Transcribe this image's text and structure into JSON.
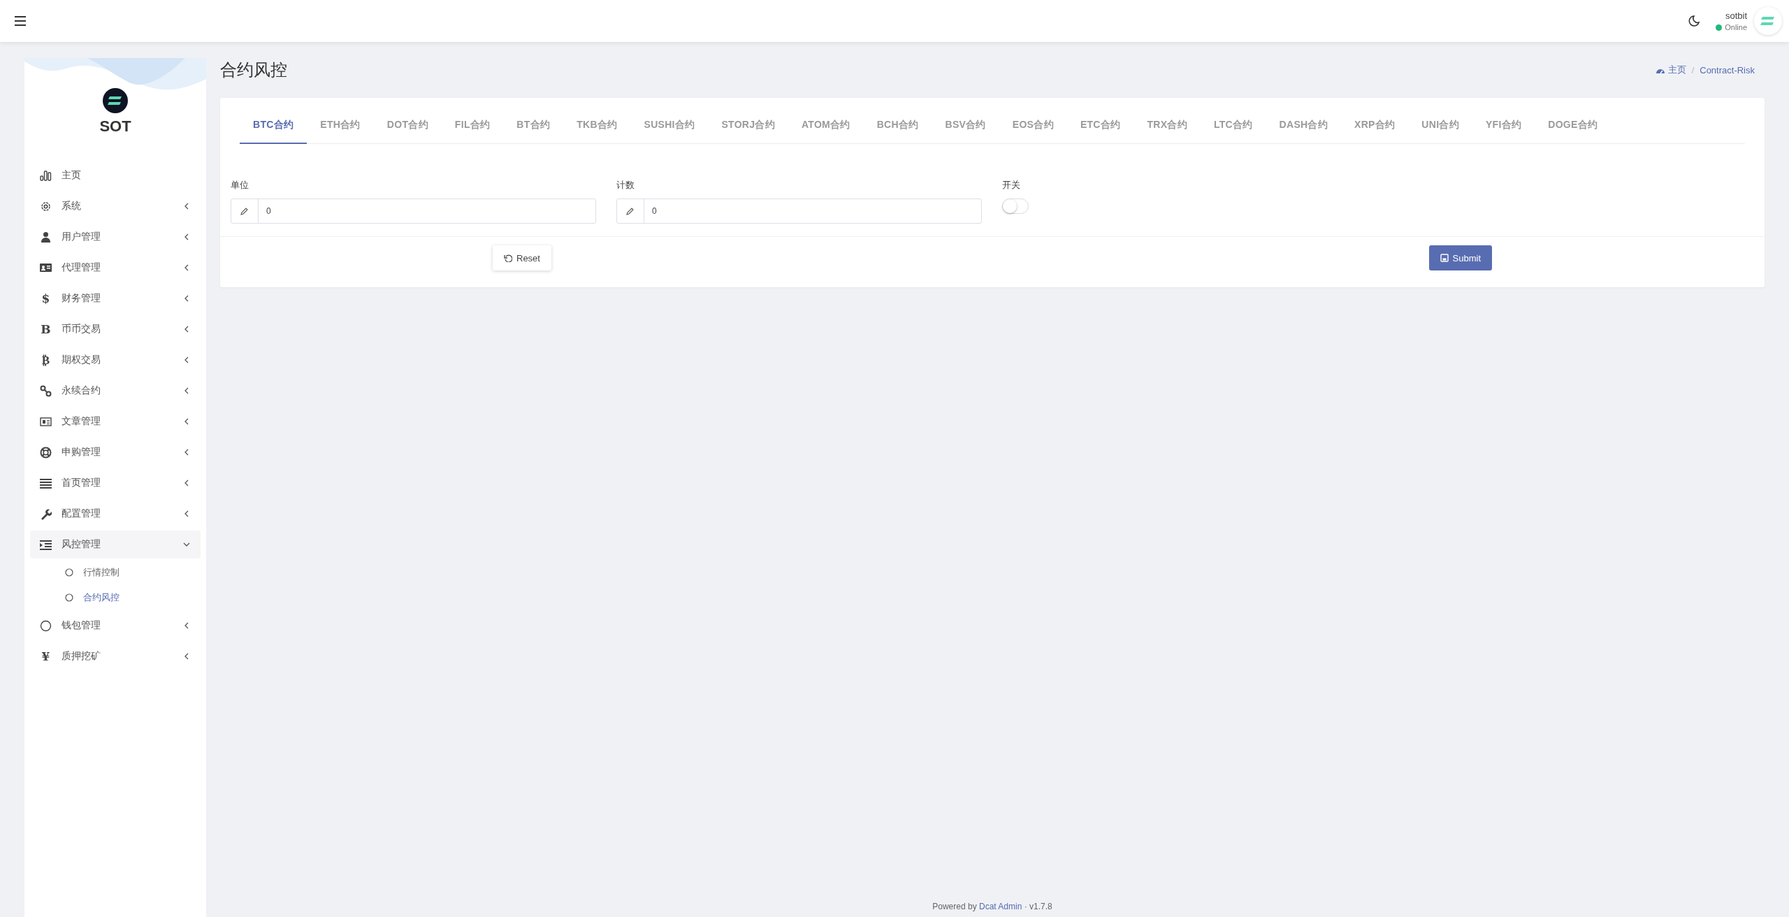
{
  "topbar": {
    "user": {
      "name": "sotbit",
      "status": "Online",
      "online": true
    }
  },
  "sidebar": {
    "brand": "SOT",
    "items": [
      {
        "label": "主页",
        "kind": "link"
      },
      {
        "label": "系统",
        "kind": "group",
        "expanded": false
      },
      {
        "label": "用户管理",
        "kind": "group",
        "expanded": false
      },
      {
        "label": "代理管理",
        "kind": "group",
        "expanded": false
      },
      {
        "label": "财务管理",
        "glyph": "$",
        "kind": "group",
        "expanded": false
      },
      {
        "label": "币币交易",
        "glyph": "B",
        "kind": "group",
        "expanded": false
      },
      {
        "label": "期权交易",
        "glyph": "₿",
        "kind": "group",
        "expanded": false
      },
      {
        "label": "永续合约",
        "kind": "group",
        "expanded": false
      },
      {
        "label": "文章管理",
        "kind": "group",
        "expanded": false
      },
      {
        "label": "申购管理",
        "kind": "group",
        "expanded": false
      },
      {
        "label": "首页管理",
        "kind": "group",
        "expanded": false
      },
      {
        "label": "配置管理",
        "kind": "group",
        "expanded": false
      },
      {
        "label": "风控管理",
        "kind": "group",
        "expanded": true,
        "children": [
          {
            "label": "行情控制",
            "selected": false
          },
          {
            "label": "合约风控",
            "selected": true
          }
        ]
      },
      {
        "label": "钱包管理",
        "kind": "group",
        "expanded": false
      },
      {
        "label": "质押挖矿",
        "glyph": "¥",
        "kind": "group",
        "expanded": false
      }
    ]
  },
  "header": {
    "title": "合约风控",
    "separator": "/",
    "breadcrumb": [
      {
        "label": "主页"
      },
      {
        "label": "Contract-Risk"
      }
    ]
  },
  "tabs": [
    {
      "label": "BTC合约",
      "selected": true
    },
    {
      "label": "ETH合约",
      "selected": false
    },
    {
      "label": "DOT合约",
      "selected": false
    },
    {
      "label": "FIL合约",
      "selected": false
    },
    {
      "label": "BT合约",
      "selected": false
    },
    {
      "label": "TKB合约",
      "selected": false
    },
    {
      "label": "SUSHI合约",
      "selected": false
    },
    {
      "label": "STORJ合约",
      "selected": false
    },
    {
      "label": "ATOM合约",
      "selected": false
    },
    {
      "label": "BCH合约",
      "selected": false
    },
    {
      "label": "BSV合约",
      "selected": false
    },
    {
      "label": "EOS合约",
      "selected": false
    },
    {
      "label": "ETC合约",
      "selected": false
    },
    {
      "label": "TRX合约",
      "selected": false
    },
    {
      "label": "LTC合约",
      "selected": false
    },
    {
      "label": "DASH合约",
      "selected": false
    },
    {
      "label": "XRP合约",
      "selected": false
    },
    {
      "label": "UNI合约",
      "selected": false
    },
    {
      "label": "YFI合约",
      "selected": false
    },
    {
      "label": "DOGE合约",
      "selected": false
    }
  ],
  "form": {
    "fields": [
      {
        "label": "单位",
        "kind": "text",
        "value": "0"
      },
      {
        "label": "计数",
        "kind": "text",
        "value": "0"
      },
      {
        "label": "开关",
        "kind": "switch",
        "on": false
      }
    ],
    "buttons": [
      {
        "label": "Reset",
        "kind": "reset"
      },
      {
        "label": "Submit",
        "kind": "submit"
      }
    ]
  },
  "footer": {
    "prefix": "Powered by",
    "link": "Dcat Admin",
    "separator": "·",
    "version": "v1.7.8"
  }
}
